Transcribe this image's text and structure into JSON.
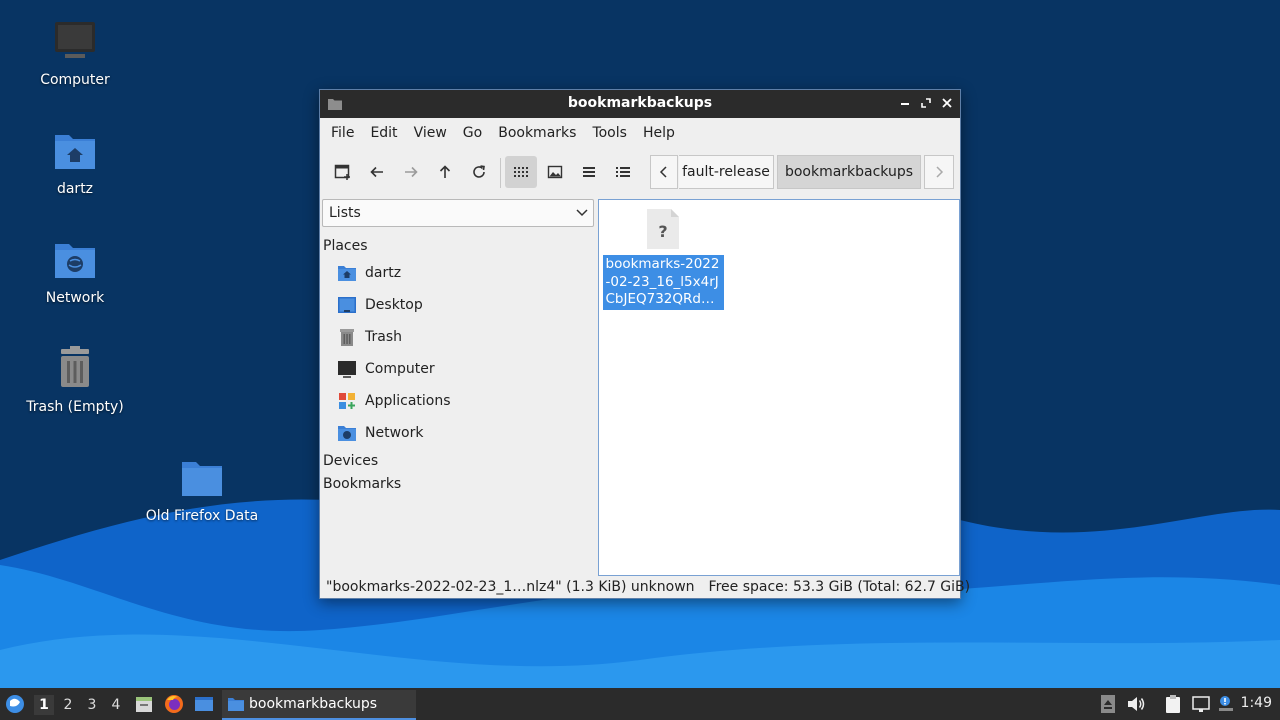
{
  "desktop": {
    "icons": [
      {
        "label": "Computer"
      },
      {
        "label": "dartz"
      },
      {
        "label": "Network"
      },
      {
        "label": "Trash (Empty)"
      },
      {
        "label": "Old Firefox Data"
      }
    ]
  },
  "window": {
    "title": "bookmarkbackups",
    "menu": [
      "File",
      "Edit",
      "View",
      "Go",
      "Bookmarks",
      "Tools",
      "Help"
    ],
    "path": [
      "fault-release",
      "bookmarkbackups"
    ],
    "sidebar": {
      "combo_value": "Lists",
      "places_heading": "Places",
      "places": [
        {
          "label": "dartz",
          "icon": "home-folder-icon"
        },
        {
          "label": "Desktop",
          "icon": "desktop-icon"
        },
        {
          "label": "Trash",
          "icon": "trash-icon"
        },
        {
          "label": "Computer",
          "icon": "computer-icon"
        },
        {
          "label": "Applications",
          "icon": "applications-icon"
        },
        {
          "label": "Network",
          "icon": "network-icon"
        }
      ],
      "devices_heading": "Devices",
      "bookmarks_heading": "Bookmarks"
    },
    "files": [
      {
        "name": "bookmarks-2022-02-23_16_l5x4rJCbJEQ732QRd…",
        "icon": "unknown-file-icon",
        "selected": true
      }
    ],
    "status": {
      "selection": "\"bookmarks-2022-02-23_1…nlz4\" (1.3 KiB) unknown",
      "free_space": "Free space: 53.3 GiB (Total: 62.7 GiB)"
    }
  },
  "panel": {
    "workspaces": [
      "1",
      "2",
      "3",
      "4"
    ],
    "active_workspace": "1",
    "task": "bookmarkbackups",
    "clock": "1:49"
  },
  "colors": {
    "desktop_bg": "#083463",
    "selection": "#3d8ee5",
    "folder_blue": "#4a8fe0"
  }
}
